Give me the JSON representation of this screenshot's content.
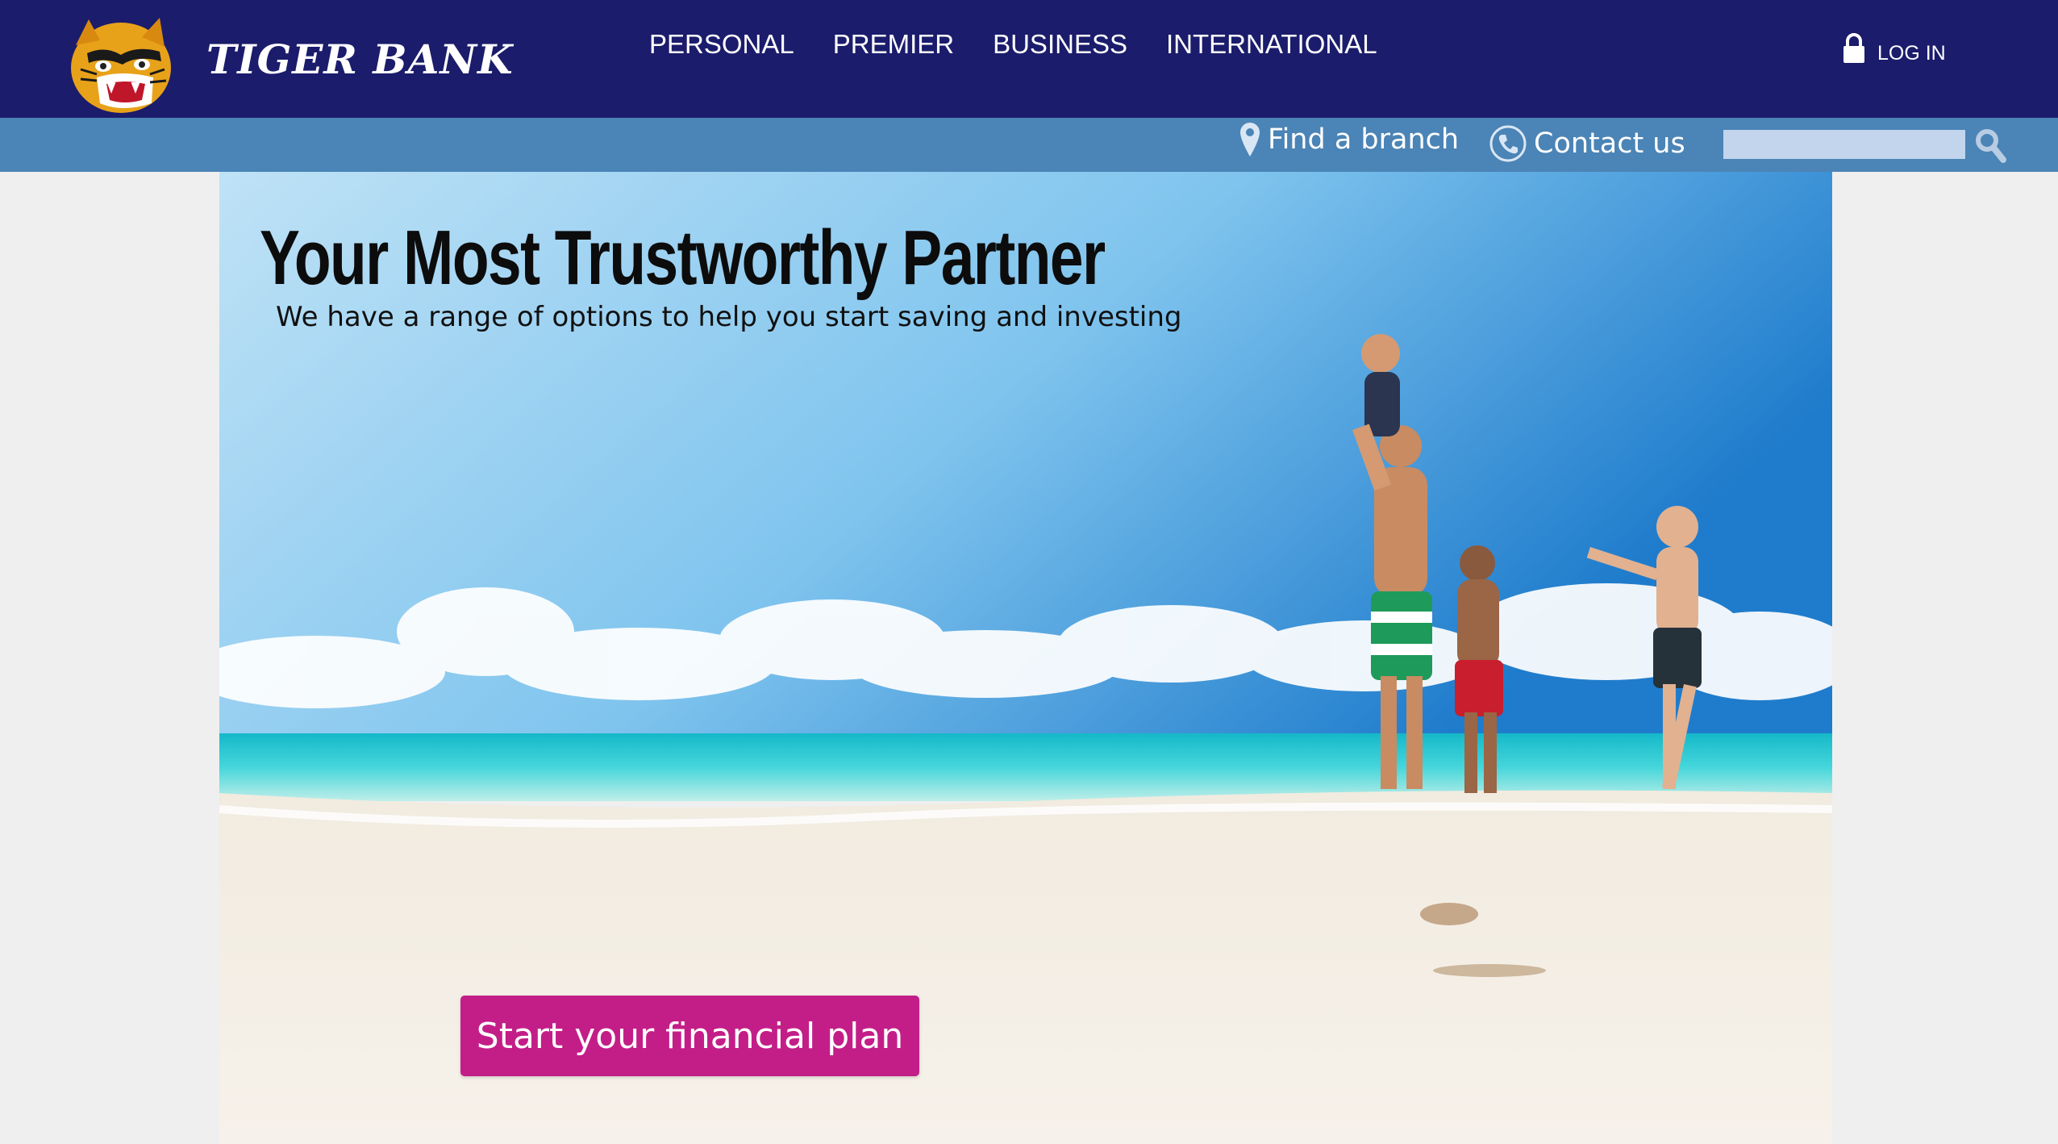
{
  "brand": {
    "name": "TIGER BANK",
    "logo_icon": "tiger-head-icon"
  },
  "main_nav": {
    "items": [
      {
        "label": "PERSONAL"
      },
      {
        "label": "PREMIER"
      },
      {
        "label": "BUSINESS"
      },
      {
        "label": "INTERNATIONAL"
      }
    ]
  },
  "login": {
    "label": "LOG IN",
    "icon": "lock-icon"
  },
  "utility_bar": {
    "find_branch": {
      "label": "Find a branch",
      "icon": "map-pin-icon"
    },
    "contact_us": {
      "label": "Contact us",
      "icon": "phone-icon"
    },
    "search": {
      "value": "",
      "placeholder": "",
      "icon": "search-icon"
    }
  },
  "hero": {
    "title": "Your Most Trustworthy Partner",
    "subtitle": "We have a range of options to help you start saving and investing",
    "cta_label": "Start your financial plan"
  },
  "colors": {
    "topbar": "#1b1c6b",
    "utility_bar": "#4b84b6",
    "cta": "#c31e88",
    "page_background": "#efefef"
  }
}
